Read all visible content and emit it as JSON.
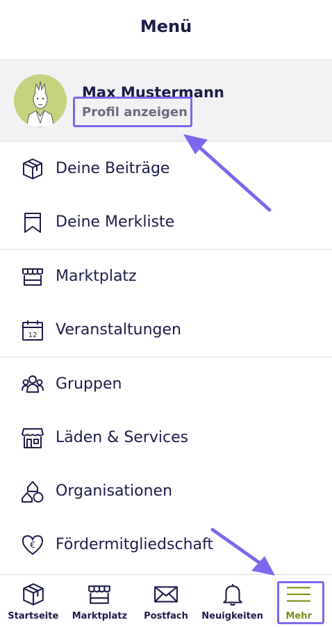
{
  "header": {
    "title": "Menü"
  },
  "profile": {
    "name": "Max Mustermann",
    "link_label": "Profil anzeigen"
  },
  "menu": {
    "group1": [
      {
        "label": "Deine Beiträge",
        "icon": "box-icon"
      },
      {
        "label": "Deine Merkliste",
        "icon": "bookmark-icon"
      }
    ],
    "group2": [
      {
        "label": "Marktplatz",
        "icon": "market-stall-icon"
      },
      {
        "label": "Veranstaltungen",
        "icon": "calendar-icon",
        "icon_text": "12"
      }
    ],
    "group3": [
      {
        "label": "Gruppen",
        "icon": "group-icon"
      },
      {
        "label": "Läden & Services",
        "icon": "shop-icon"
      },
      {
        "label": "Organisationen",
        "icon": "shapes-icon"
      },
      {
        "label": "Fördermitgliedschaft",
        "icon": "heart-euro-icon",
        "icon_text": "€"
      }
    ]
  },
  "bottom_nav": [
    {
      "label": "Startseite",
      "icon": "home-box-icon"
    },
    {
      "label": "Marktplatz",
      "icon": "market-stall-icon"
    },
    {
      "label": "Postfach",
      "icon": "mail-icon"
    },
    {
      "label": "Neuigkeiten",
      "icon": "bell-icon"
    },
    {
      "label": "Mehr",
      "icon": "hamburger-icon",
      "active": true
    }
  ],
  "colors": {
    "text": "#1c1c4a",
    "accent": "#7a8e17",
    "highlight": "#7b68ee",
    "avatar_bg": "#c5d37f"
  }
}
